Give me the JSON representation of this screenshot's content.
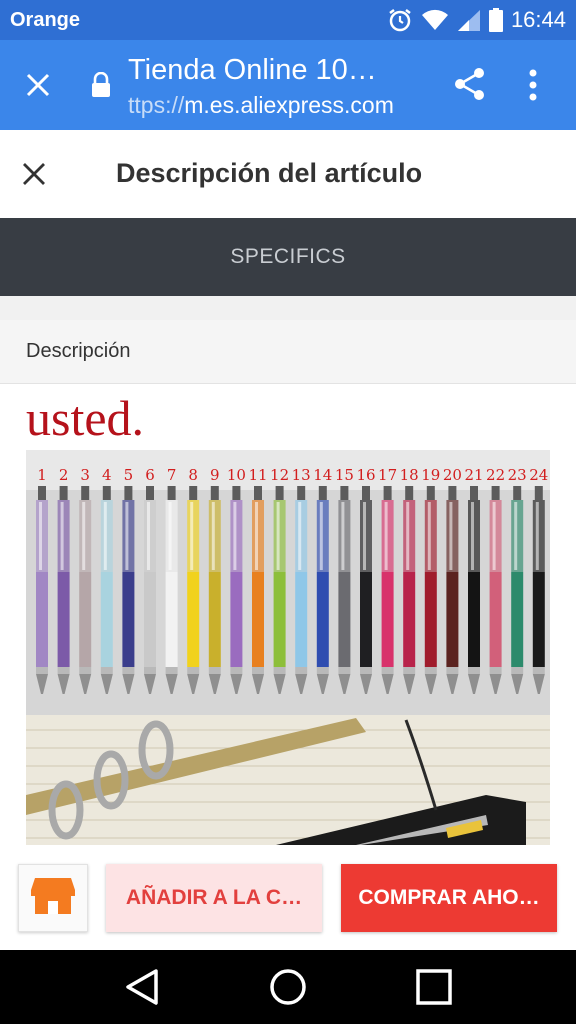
{
  "status_bar": {
    "carrier": "Orange",
    "time": "16:44",
    "icons": [
      "alarm-icon",
      "wifi-icon",
      "signal-icon",
      "battery-icon"
    ]
  },
  "browser": {
    "title": "Tienda Online 10…",
    "url_prefix": "ttps://",
    "url_host": "m.es.aliexpress.com",
    "icons": [
      "close-icon",
      "lock-icon",
      "share-icon",
      "more-icon"
    ]
  },
  "page": {
    "title": "Descripción del artículo",
    "tab_label": "SPECIFICS",
    "section_label": "Descripción",
    "description_text": "usted."
  },
  "product_image": {
    "pen_numbers": [
      "1",
      "2",
      "3",
      "4",
      "5",
      "6",
      "7",
      "8",
      "9",
      "10",
      "11",
      "12",
      "13",
      "14",
      "15",
      "16",
      "17",
      "18",
      "19",
      "20",
      "21",
      "22",
      "23",
      "24"
    ],
    "pen_colors": [
      "#a187c4",
      "#7c5aa8",
      "#b5a6a8",
      "#a9d3df",
      "#3b3e8c",
      "#c9c9c9",
      "#f2f2f2",
      "#f1d21c",
      "#c9b02c",
      "#9a6cbf",
      "#e8801f",
      "#8dbf3a",
      "#8fc7e8",
      "#2f4db0",
      "#6b6b70",
      "#1f1f22",
      "#d8326b",
      "#b8234a",
      "#a01c2c",
      "#5b2320",
      "#141414",
      "#d2607a",
      "#2c8a6b",
      "#1a1a1a"
    ]
  },
  "actions": {
    "add_to_cart": "AÑADIR A LA C…",
    "buy_now": "COMPRAR AHO…",
    "store_icon": "store-icon"
  },
  "colors": {
    "status_bar": "#2f6fd3",
    "toolbar": "#3b86ea",
    "specifics_band": "#383d44",
    "accent_red": "#ed3a33",
    "store_orange": "#f47b20"
  }
}
